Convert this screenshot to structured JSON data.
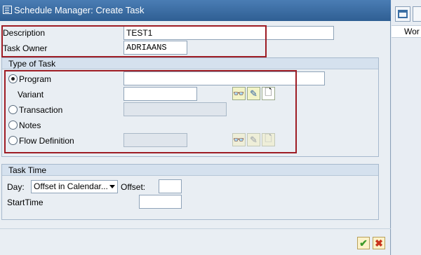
{
  "window": {
    "title": "Schedule Manager: Create Task"
  },
  "background_pane": {
    "column_header": "Wor"
  },
  "general": {
    "description_label": "Description",
    "description_value": "TEST1",
    "task_owner_label": "Task Owner",
    "task_owner_value": "ADRIAANS"
  },
  "type_of_task": {
    "header": "Type of Task",
    "program_label": "Program",
    "program_value": "",
    "variant_label": "Variant",
    "variant_value": "",
    "transaction_label": "Transaction",
    "transaction_value": "",
    "notes_label": "Notes",
    "flow_definition_label": "Flow Definition",
    "flow_definition_value": "",
    "selected": "Program"
  },
  "task_time": {
    "header": "Task Time",
    "day_label": "Day:",
    "day_selected": "Offset in Calendar...",
    "offset_label": "Offset:",
    "offset_value": "",
    "start_time_label": "StartTime",
    "start_time_value": ""
  },
  "colors": {
    "title_bar": "#3a6ea5",
    "highlight_frame": "#9e1c24",
    "group_header": "#d5e1ee",
    "confirm_icon": "#3c9a2a",
    "cancel_icon": "#c8341c"
  }
}
